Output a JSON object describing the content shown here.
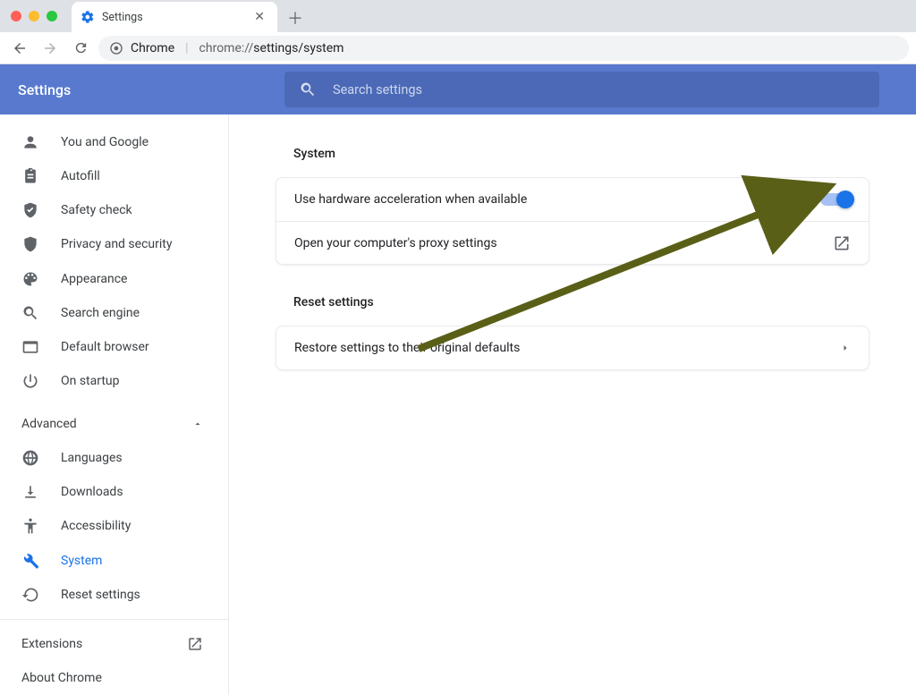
{
  "window": {
    "tab_title": "Settings",
    "url_product": "Chrome",
    "url_scheme": "chrome://",
    "url_path": "settings/system"
  },
  "header": {
    "title": "Settings",
    "search_placeholder": "Search settings"
  },
  "sidebar": {
    "items": [
      {
        "icon": "person",
        "label": "You and Google"
      },
      {
        "icon": "clipboard",
        "label": "Autofill"
      },
      {
        "icon": "shield-check",
        "label": "Safety check"
      },
      {
        "icon": "shield",
        "label": "Privacy and security"
      },
      {
        "icon": "palette",
        "label": "Appearance"
      },
      {
        "icon": "search",
        "label": "Search engine"
      },
      {
        "icon": "browser",
        "label": "Default browser"
      },
      {
        "icon": "power",
        "label": "On startup"
      }
    ],
    "advanced_label": "Advanced",
    "advanced_items": [
      {
        "icon": "globe",
        "label": "Languages"
      },
      {
        "icon": "download",
        "label": "Downloads"
      },
      {
        "icon": "accessibility",
        "label": "Accessibility"
      },
      {
        "icon": "wrench",
        "label": "System",
        "active": true
      },
      {
        "icon": "restore",
        "label": "Reset settings"
      }
    ],
    "footer": {
      "extensions": "Extensions",
      "about": "About Chrome"
    }
  },
  "content": {
    "section_system": {
      "title": "System",
      "hw_accel_label": "Use hardware acceleration when available",
      "hw_accel_on": true,
      "proxy_label": "Open your computer's proxy settings"
    },
    "section_reset": {
      "title": "Reset settings",
      "restore_label": "Restore settings to their original defaults"
    }
  }
}
